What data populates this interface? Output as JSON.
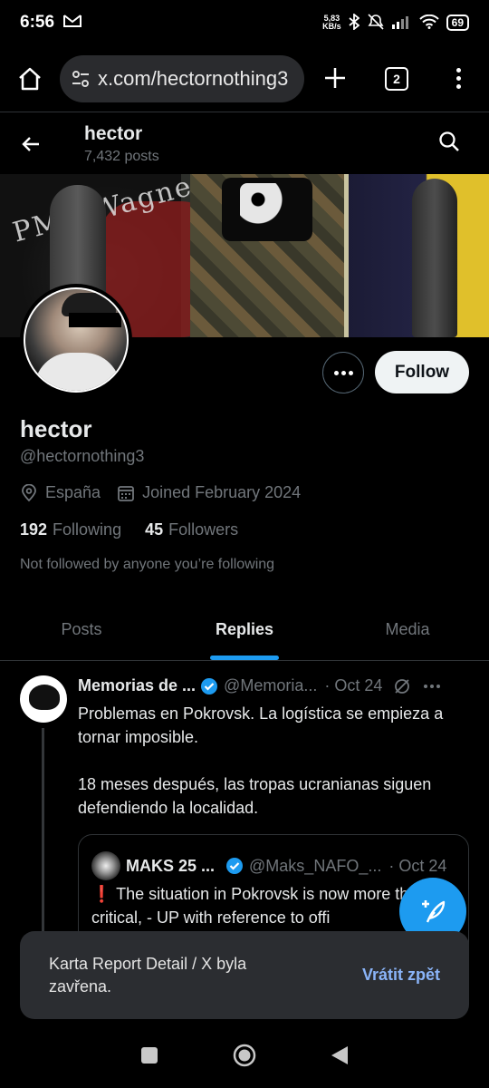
{
  "status_bar": {
    "time": "6:56",
    "speed_value": "5,83",
    "speed_unit": "KB/s",
    "battery": "69"
  },
  "browser": {
    "url": "x.com/hectornothing3",
    "tab_count": "2"
  },
  "profile_header": {
    "name": "hector",
    "posts": "7,432 posts"
  },
  "profile": {
    "display_name": "hector",
    "handle": "@hectornothing3",
    "location": "España",
    "joined": "Joined February 2024",
    "following_count": "192",
    "following_label": "Following",
    "followers_count": "45",
    "followers_label": "Followers",
    "not_followed": "Not followed by anyone you’re following",
    "follow_label": "Follow"
  },
  "banner": {
    "text": "PMC Wagner Gro"
  },
  "tabs": [
    {
      "label": "Posts",
      "active": false
    },
    {
      "label": "Replies",
      "active": true
    },
    {
      "label": "Media",
      "active": false
    }
  ],
  "tweet": {
    "name": "Memorias de ...",
    "handle": "@Memoria...",
    "date": "· Oct 24",
    "text": "Problemas en Pokrovsk. La logística se empieza a tornar imposible.\n\n18 meses después, las tropas ucranianas siguen defendiendo la localidad."
  },
  "quote": {
    "name": "MAKS 25 ...",
    "handle": "@Maks_NAFO_...",
    "date": "· Oct 24",
    "exclamation": "❗",
    "text": "The situation in Pokrovsk is now more than critical, - UP with reference to offi"
  },
  "toast": {
    "message": "Karta Report Detail / X byla zavřena.",
    "action": "Vrátit zpět"
  },
  "colors": {
    "accent": "#1d9bf0",
    "background": "#000000",
    "secondary_text": "#71767b"
  }
}
